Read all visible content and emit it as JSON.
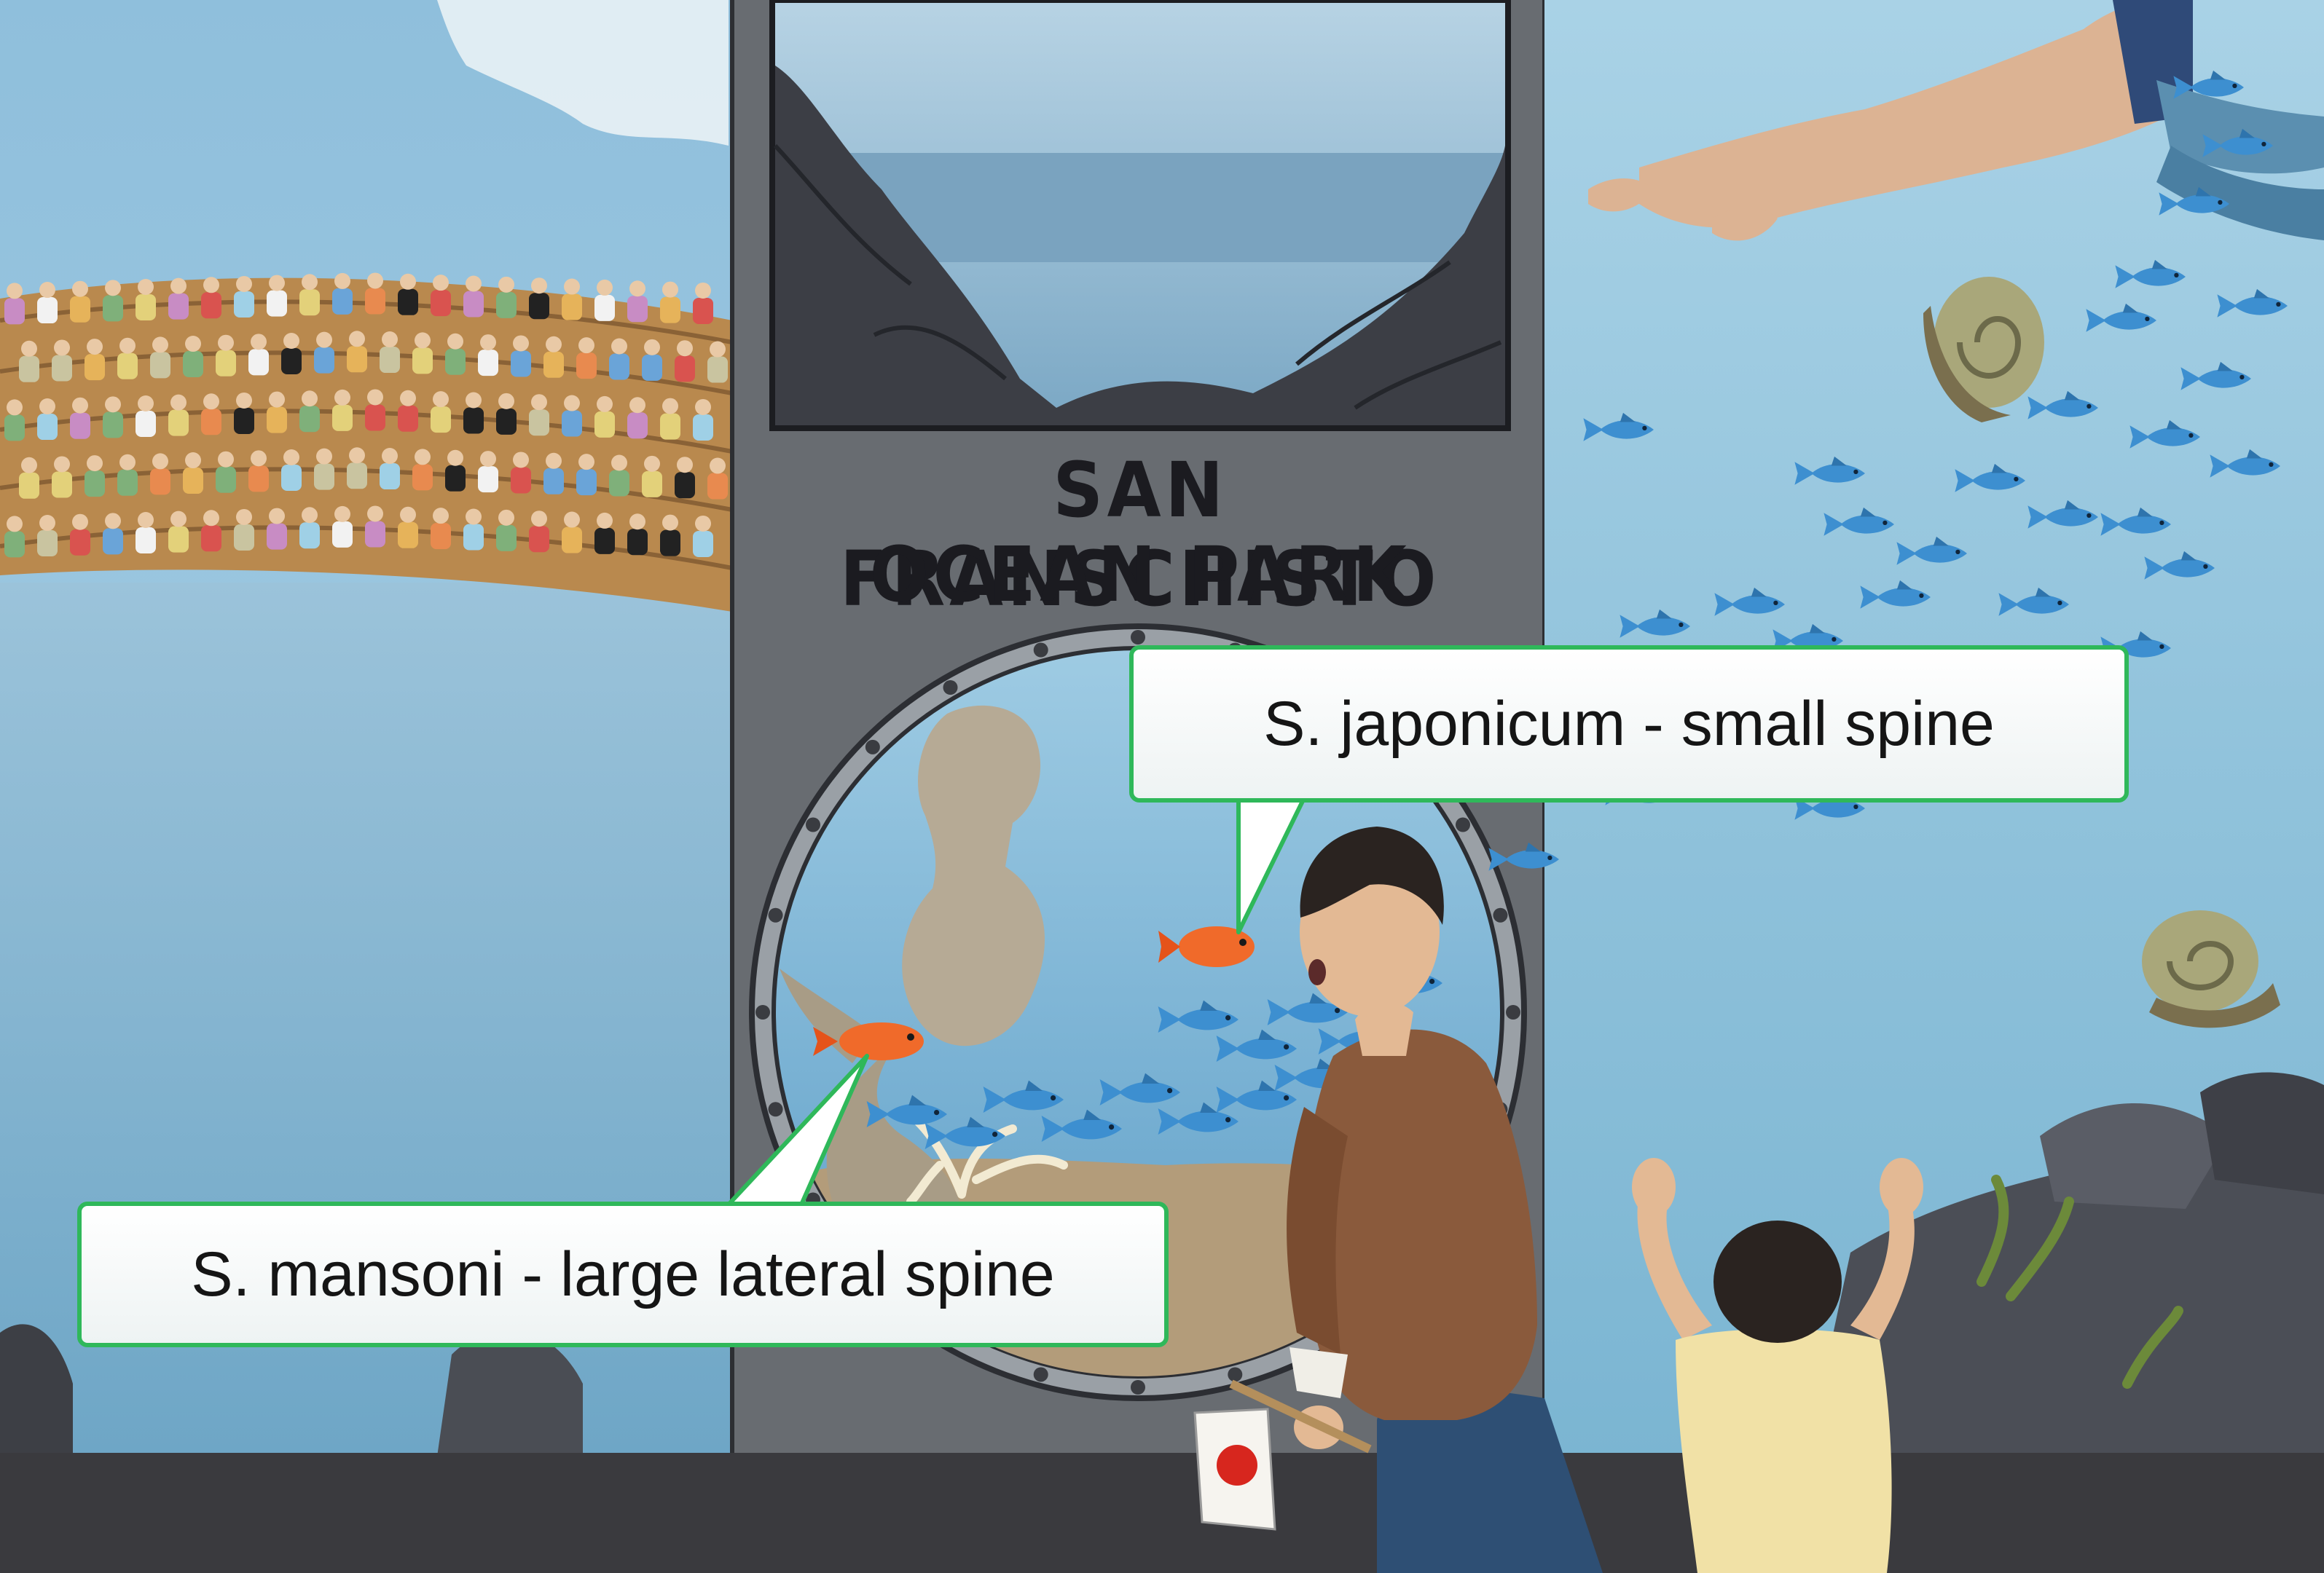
{
  "sign": {
    "line1": "SAN FRANSCHISTO",
    "line2": "OCEAN PARK"
  },
  "callouts": {
    "japonicum": "S. japonicum - small spine",
    "mansoni": "S. mansoni - large lateral spine"
  },
  "colors": {
    "callout_border": "#2fb85a",
    "water": "#7fb2d0",
    "sky": "#9cc6de",
    "wall": "#6f7379",
    "floor": "#3a3a3e"
  }
}
